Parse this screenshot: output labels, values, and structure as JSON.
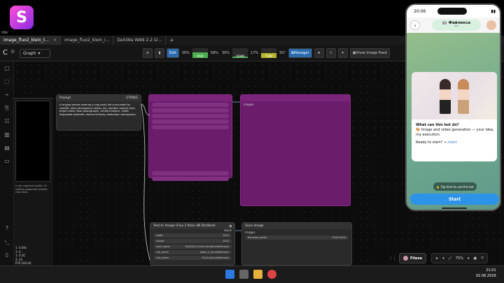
{
  "app": {
    "logo_letter": "S",
    "window_label": "Idle"
  },
  "tabs": [
    {
      "label": "image_flux2_klein_t..."
    },
    {
      "label": "image_flux2_klein_i..."
    },
    {
      "label": "DaSiWa WAN 2.2 I2..."
    }
  ],
  "toolbar": {
    "graph_label": "Graph",
    "edit_label": "Edit",
    "manager_label": "Manager",
    "show_feed_label": "Show Image Feed",
    "meters": [
      {
        "label": "CPU",
        "value": "30%",
        "level": 0.3
      },
      {
        "label": "RAM",
        "value": "58%",
        "level": 0.58
      },
      {
        "label": "GPU",
        "value": "30%",
        "level": 0.3
      },
      {
        "label": "VRAM",
        "value": "17%",
        "level": 0.17
      },
      {
        "label": "TEMP",
        "value": "50°",
        "level": 0.5
      }
    ]
  },
  "prompt_node": {
    "title": "Prompt",
    "output": "STRING",
    "text": "a longing woman wearing a crop party hat surrounded by confetti, party atmosphere, ballon, joy, daylight camera style, bright colors, flash photography, candid moment, 1980s disposable aesthetic, festive birthday celebration atmosphere."
  },
  "left_panel": {
    "message": "n the required models. Or slightly-supported models may build.",
    "stats": [
      "1: 0.00s",
      "1: 0",
      "1: 0.3C",
      "4: 41",
      "FPS 183.00"
    ]
  },
  "t2i_node": {
    "title": "Text to Image (Flux 2 Klein 4B Distilled)",
    "output": "IMAGE",
    "rows": [
      {
        "name": "width",
        "value": "1024"
      },
      {
        "name": "height",
        "value": "1024"
      },
      {
        "name": "unet_name",
        "value": "flux2flux-2-klein-4b-fp8.safetensors"
      },
      {
        "name": "clip_name",
        "value": "qwen_3_4b.safetensors"
      },
      {
        "name": "vae_name",
        "value": "flux2-vae.safetensors"
      }
    ]
  },
  "save_node": {
    "title": "Save Image",
    "input": "images",
    "filename_label": "filename_prefix",
    "filename_value": "Flux2-Klein"
  },
  "bottom": {
    "user_name": "Filexa",
    "zoom": "75%"
  },
  "clock": {
    "time": "21:01",
    "date": "02.06.2026"
  },
  "phone": {
    "status_time": "20:06",
    "bot_name": "🤖 Файлекса",
    "bot_sub": "bot",
    "question": "What can this bot do?",
    "description": "🎨 Image and video generation — your idea, my execution.",
    "ready": "Ready to start? → ",
    "ready_link": "/start",
    "tip": "👆 Tap here to use this bot",
    "start_label": "Start"
  },
  "colors": {
    "accent": "#2b6cb0",
    "pink_node": "#6b1d6b",
    "telegram_blue": "#2d93e8"
  }
}
